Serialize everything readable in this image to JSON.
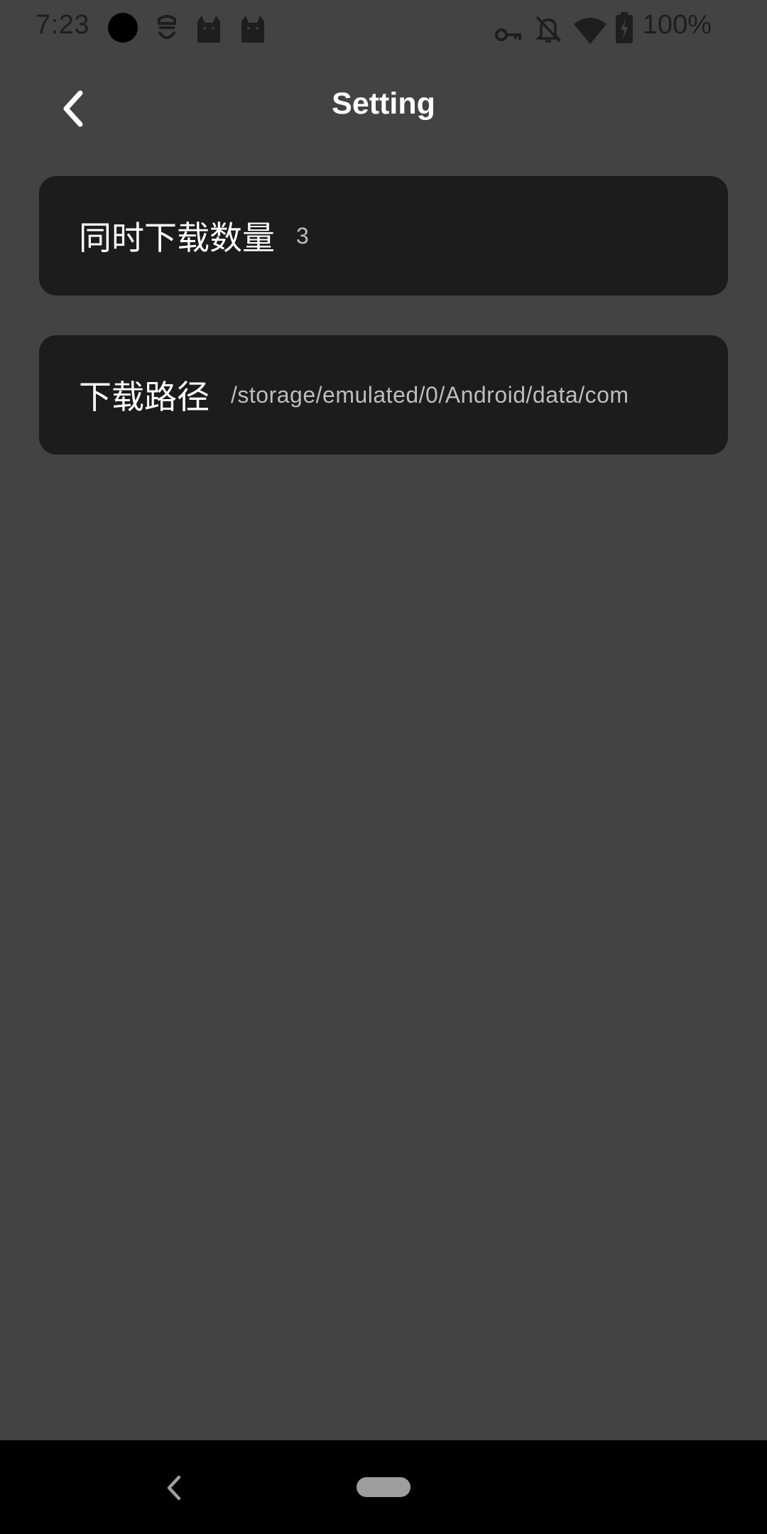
{
  "status_bar": {
    "time": "7:23",
    "battery_text": "100%",
    "left_icons": [
      "circle-icon",
      "notification-app-icon",
      "cat-app-icon",
      "cat-app-icon"
    ],
    "right_icons": [
      "vpn-key-icon",
      "bell-off-icon",
      "wifi-icon",
      "battery-charging-icon"
    ]
  },
  "app_bar": {
    "title": "Setting",
    "back_icon": "chevron-left-icon"
  },
  "settings": [
    {
      "label": "同时下载数量",
      "value": "3"
    },
    {
      "label": "下载路径",
      "value": "/storage/emulated/0/Android/data/com"
    }
  ],
  "nav_bar": {
    "back_icon": "nav-back-icon",
    "home_icon": "nav-home-pill"
  },
  "colors": {
    "background": "#434343",
    "card": "#1c1c1c",
    "title": "#ffffff",
    "value": "#bdbdbd",
    "nav_bar": "#000000"
  }
}
